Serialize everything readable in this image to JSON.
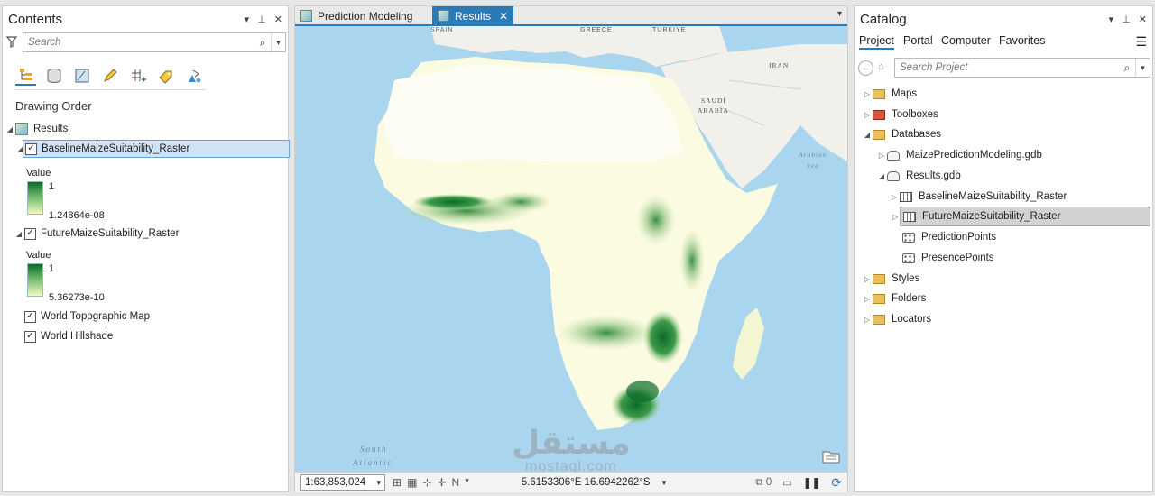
{
  "contents": {
    "title": "Contents",
    "search_placeholder": "Search",
    "drawing_order": "Drawing Order",
    "map_name": "Results",
    "layers": [
      {
        "name": "BaselineMaizeSuitability_Raster",
        "legend_title": "Value",
        "high": "1",
        "low": "1.24864e-08",
        "checked": true
      },
      {
        "name": "FutureMaizeSuitability_Raster",
        "legend_title": "Value",
        "high": "1",
        "low": "5.36273e-10",
        "checked": true
      },
      {
        "name": "World Topographic Map",
        "checked": true
      },
      {
        "name": "World Hillshade",
        "checked": true
      }
    ]
  },
  "tabs": [
    {
      "label": "Prediction Modeling",
      "active": false
    },
    {
      "label": "Results",
      "active": true
    }
  ],
  "map_labels": {
    "greece": "GREECE",
    "turkiye": "TÜRKIYE",
    "spain": "SPAIN",
    "iran": "IRAN",
    "saudi1": "SAUDI",
    "saudi2": "ARABIA",
    "arabian1": "Arabian",
    "arabian2": "Sea",
    "south": "South",
    "atlantic": "Atlantic"
  },
  "status": {
    "scale": "1:63,853,024",
    "coordinates": "5.6153306°E 16.6942262°S",
    "selected_count": "0"
  },
  "catalog": {
    "title": "Catalog",
    "tabs": [
      "Project",
      "Portal",
      "Computer",
      "Favorites"
    ],
    "search_placeholder": "Search Project",
    "items": {
      "maps": "Maps",
      "toolboxes": "Toolboxes",
      "databases": "Databases",
      "gdb1": "MaizePredictionModeling.gdb",
      "gdb2": "Results.gdb",
      "r1": "BaselineMaizeSuitability_Raster",
      "r2": "FutureMaizeSuitability_Raster",
      "fc1": "PredictionPoints",
      "fc2": "PresencePoints",
      "styles": "Styles",
      "folders": "Folders",
      "locators": "Locators"
    }
  },
  "watermark": {
    "line1": "مستقل",
    "line2": "mostaql.com"
  },
  "colors": {
    "accent": "#2a7ab8",
    "ocean": "#a9d6ee",
    "land": "#fbfbe2",
    "desert": "#fdfdf3",
    "suitability_high": "#0a6b2a"
  }
}
